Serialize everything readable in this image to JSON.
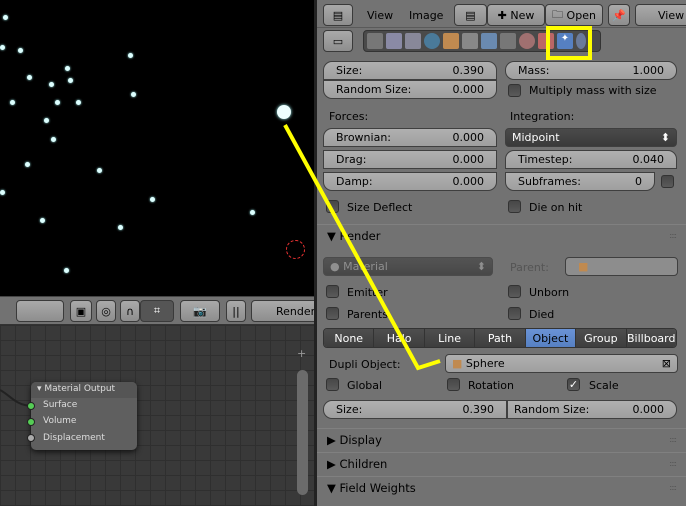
{
  "header": {
    "view": "View",
    "image": "Image",
    "new": "New",
    "open": "Open",
    "view2": "View"
  },
  "viewport_header": {
    "render": "Render"
  },
  "node": {
    "title": "Material Output",
    "sockets": [
      "Surface",
      "Volume",
      "Displacement"
    ]
  },
  "physics": {
    "size_label": "Size:",
    "size": "0.390",
    "random_size_label": "Random Size:",
    "random_size": "0.000",
    "mass_label": "Mass:",
    "mass": "1.000",
    "multiply_mass": "Multiply mass with size",
    "forces": "Forces:",
    "integration": "Integration:",
    "brownian_label": "Brownian:",
    "brownian": "0.000",
    "integrator": "Midpoint",
    "drag_label": "Drag:",
    "drag": "0.000",
    "timestep_label": "Timestep:",
    "timestep": "0.040",
    "damp_label": "Damp:",
    "damp": "0.000",
    "subframes_label": "Subframes:",
    "subframes": "0",
    "size_deflect": "Size Deflect",
    "die_on_hit": "Die on hit"
  },
  "render": {
    "title": "Render",
    "material": "Material",
    "parent_label": "Parent:",
    "emitter": "Emitter",
    "unborn": "Unborn",
    "parents": "Parents",
    "died": "Died",
    "types": [
      "None",
      "Halo",
      "Line",
      "Path",
      "Object",
      "Group",
      "Billboard"
    ],
    "active_type": "Object",
    "dupli_label": "Dupli Object:",
    "dupli_value": "Sphere",
    "global": "Global",
    "rotation": "Rotation",
    "scale": "Scale",
    "scale_checked": true,
    "size_label": "Size:",
    "size": "0.390",
    "random_size_label": "Random Size:",
    "random_size": "0.000"
  },
  "panels": {
    "display": "Display",
    "children": "Children",
    "field_weights": "Field Weights"
  },
  "colors": {
    "annotation": "#ffff00",
    "active": "#5680c2"
  }
}
